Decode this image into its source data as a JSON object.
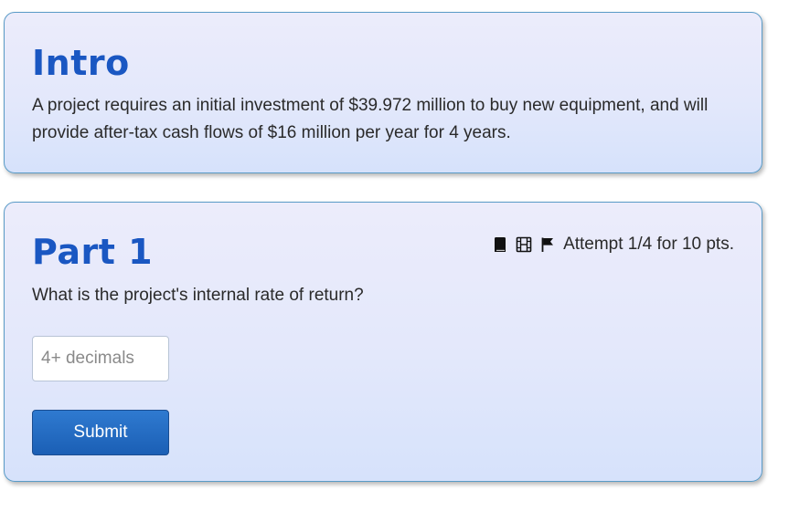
{
  "intro": {
    "title": "Intro",
    "text": "A project requires an initial investment of $39.972 million to buy new equipment, and will provide after-tax cash flows of $16 million per year for 4 years."
  },
  "part1": {
    "title": "Part 1",
    "question": "What is the project's internal rate of return?",
    "attempt": "Attempt 1/4 for 10 pts.",
    "icons": [
      "book-icon",
      "film-icon",
      "flag-icon"
    ],
    "input": {
      "placeholder": "4+ decimals",
      "value": ""
    },
    "submit_label": "Submit"
  },
  "colors": {
    "heading": "#1a57c2",
    "card_border": "#5a9bc7",
    "button": "#1b5fb5"
  }
}
